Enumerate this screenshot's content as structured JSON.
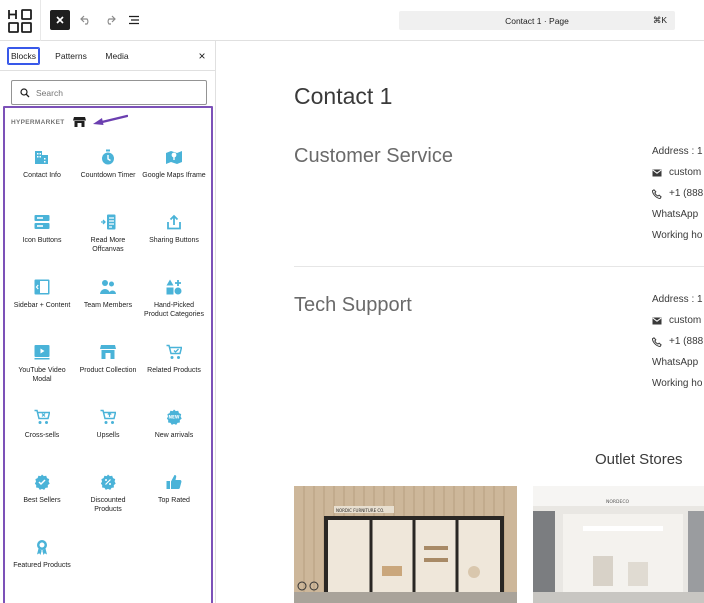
{
  "toolbar": {
    "command_title": "Contact 1 · Page",
    "command_shortcut": "⌘K",
    "logo_icon": "site-logo-icon",
    "inserter_icon": "close-icon",
    "undo_icon": "undo-icon",
    "redo_icon": "redo-icon",
    "list_view_icon": "list-view-icon"
  },
  "sidebar": {
    "tabs": [
      {
        "label": "Blocks",
        "active": true
      },
      {
        "label": "Patterns",
        "active": false
      },
      {
        "label": "Media",
        "active": false
      }
    ],
    "close_label": "×",
    "search": {
      "placeholder": "Search",
      "value": ""
    },
    "category": {
      "label": "HYPERMARKET",
      "icon": "store-icon"
    },
    "accent_color": "#7c51b8",
    "block_icon_color": "#4ab3d8",
    "blocks": [
      {
        "label": "Contact Info",
        "icon": "building-icon"
      },
      {
        "label": "Countdown Timer",
        "icon": "stopwatch-icon"
      },
      {
        "label": "Google Maps Iframe",
        "icon": "map-icon"
      },
      {
        "label": "Icon Buttons",
        "icon": "buttons-icon"
      },
      {
        "label": "Read More Offcanvas",
        "icon": "offcanvas-icon"
      },
      {
        "label": "Sharing Buttons",
        "icon": "share-icon"
      },
      {
        "label": "Sidebar + Content",
        "icon": "sidebar-icon"
      },
      {
        "label": "Team Members",
        "icon": "team-icon"
      },
      {
        "label": "Hand-Picked Product Categories",
        "icon": "categories-icon"
      },
      {
        "label": "YouTube Video Modal",
        "icon": "video-icon"
      },
      {
        "label": "Product Collection",
        "icon": "store-collection-icon"
      },
      {
        "label": "Related Products",
        "icon": "cart-icon"
      },
      {
        "label": "Cross-sells",
        "icon": "cart-icon"
      },
      {
        "label": "Upsells",
        "icon": "cart-icon"
      },
      {
        "label": "New arrivals",
        "icon": "new-badge-icon"
      },
      {
        "label": "Best Sellers",
        "icon": "check-badge-icon"
      },
      {
        "label": "Discounted Products",
        "icon": "percent-badge-icon"
      },
      {
        "label": "Top Rated",
        "icon": "thumbs-up-icon"
      },
      {
        "label": "Featured Products",
        "icon": "award-icon"
      }
    ]
  },
  "canvas": {
    "page_title": "Contact 1",
    "customer_service": {
      "title": "Customer Service",
      "address": "Address : 1",
      "email": "custom",
      "phone": "+1 (888",
      "whatsapp": "WhatsApp",
      "hours": "Working ho"
    },
    "tech_support": {
      "title": "Tech Support",
      "address": "Address : 1",
      "email": "custom",
      "phone": "+1 (888",
      "whatsapp": "WhatsApp",
      "hours": "Working ho"
    },
    "outlet_title": "Outlet Stores",
    "store_sign_1": "NORDIC FURNITURE CO.",
    "store_sign_2": "NORDECO"
  }
}
